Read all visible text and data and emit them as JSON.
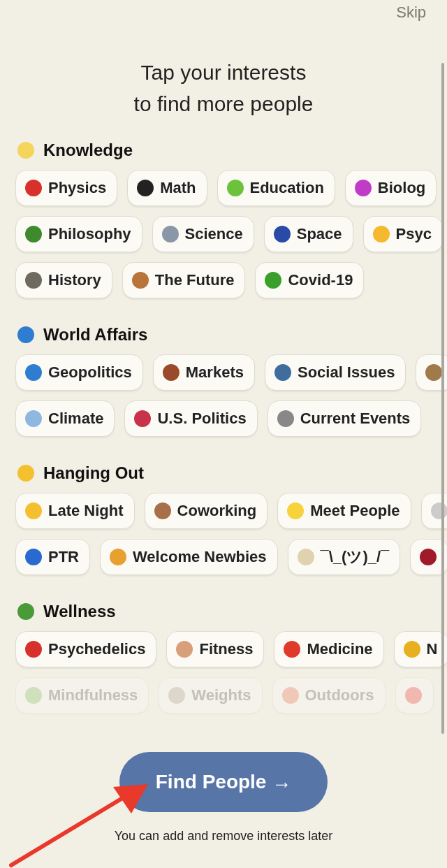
{
  "skip": "Skip",
  "title": [
    "Tap your interests",
    "to find more people"
  ],
  "sections": [
    {
      "title": "Knowledge",
      "color": "#f2d55a",
      "rows": [
        [
          {
            "label": "Physics",
            "color": "#d8302a"
          },
          {
            "label": "Math",
            "color": "#222222"
          },
          {
            "label": "Education",
            "color": "#6cc23a"
          },
          {
            "label": "Biolog",
            "color": "#c03cc8"
          }
        ],
        [
          {
            "label": "Philosophy",
            "color": "#3f8a2c"
          },
          {
            "label": "Science",
            "color": "#8a97a6"
          },
          {
            "label": "Space",
            "color": "#2a4aa8"
          },
          {
            "label": "Psyc",
            "color": "#f5b82e"
          }
        ],
        [
          {
            "label": "History",
            "color": "#6e6a60"
          },
          {
            "label": "The Future",
            "color": "#b9743a"
          },
          {
            "label": "Covid-19",
            "color": "#3aa02a"
          }
        ]
      ]
    },
    {
      "title": "World Affairs",
      "color": "#2e7dd0",
      "rows": [
        [
          {
            "label": "Geopolitics",
            "color": "#2e7dd0"
          },
          {
            "label": "Markets",
            "color": "#9a4a2a"
          },
          {
            "label": "Social Issues",
            "color": "#3f6e9e"
          },
          {
            "color": "#a07a4a"
          }
        ],
        [
          {
            "label": "Climate",
            "color": "#8fb8e0"
          },
          {
            "label": "U.S. Politics",
            "color": "#c8324a"
          },
          {
            "label": "Current Events",
            "color": "#888888"
          }
        ]
      ]
    },
    {
      "title": "Hanging Out",
      "color": "#f5c030",
      "rows": [
        [
          {
            "label": "Late Night",
            "color": "#f5c030"
          },
          {
            "label": "Coworking",
            "color": "#a8704a"
          },
          {
            "label": "Meet People",
            "color": "#f7d23a"
          },
          {
            "color": "#cccccc"
          }
        ],
        [
          {
            "label": "PTR",
            "color": "#2a6ad0"
          },
          {
            "label": "Welcome Newbies",
            "color": "#e8a030"
          },
          {
            "label": "¯\\_(ツ)_/¯",
            "color": "#e0d2b0"
          },
          {
            "color": "#a01a2a"
          }
        ]
      ]
    },
    {
      "title": "Wellness",
      "color": "#4a9a3a",
      "rows": [
        [
          {
            "label": "Psychedelics",
            "color": "#d8302a"
          },
          {
            "label": "Fitness",
            "color": "#d8a07a"
          },
          {
            "label": "Medicine",
            "color": "#e03a2a"
          },
          {
            "label": "N",
            "color": "#e8b020"
          }
        ],
        {
          "faded": true,
          "chips": [
            {
              "label": "Mindfulness",
              "color": "#cfe0bd"
            },
            {
              "label": "Weights",
              "color": "#dcd6cc"
            },
            {
              "label": "Outdoors",
              "color": "#f0c8b8"
            },
            {
              "color": "#f0b8b0"
            }
          ]
        }
      ]
    }
  ],
  "button": "Find People →",
  "footer": "You can add and remove interests later"
}
